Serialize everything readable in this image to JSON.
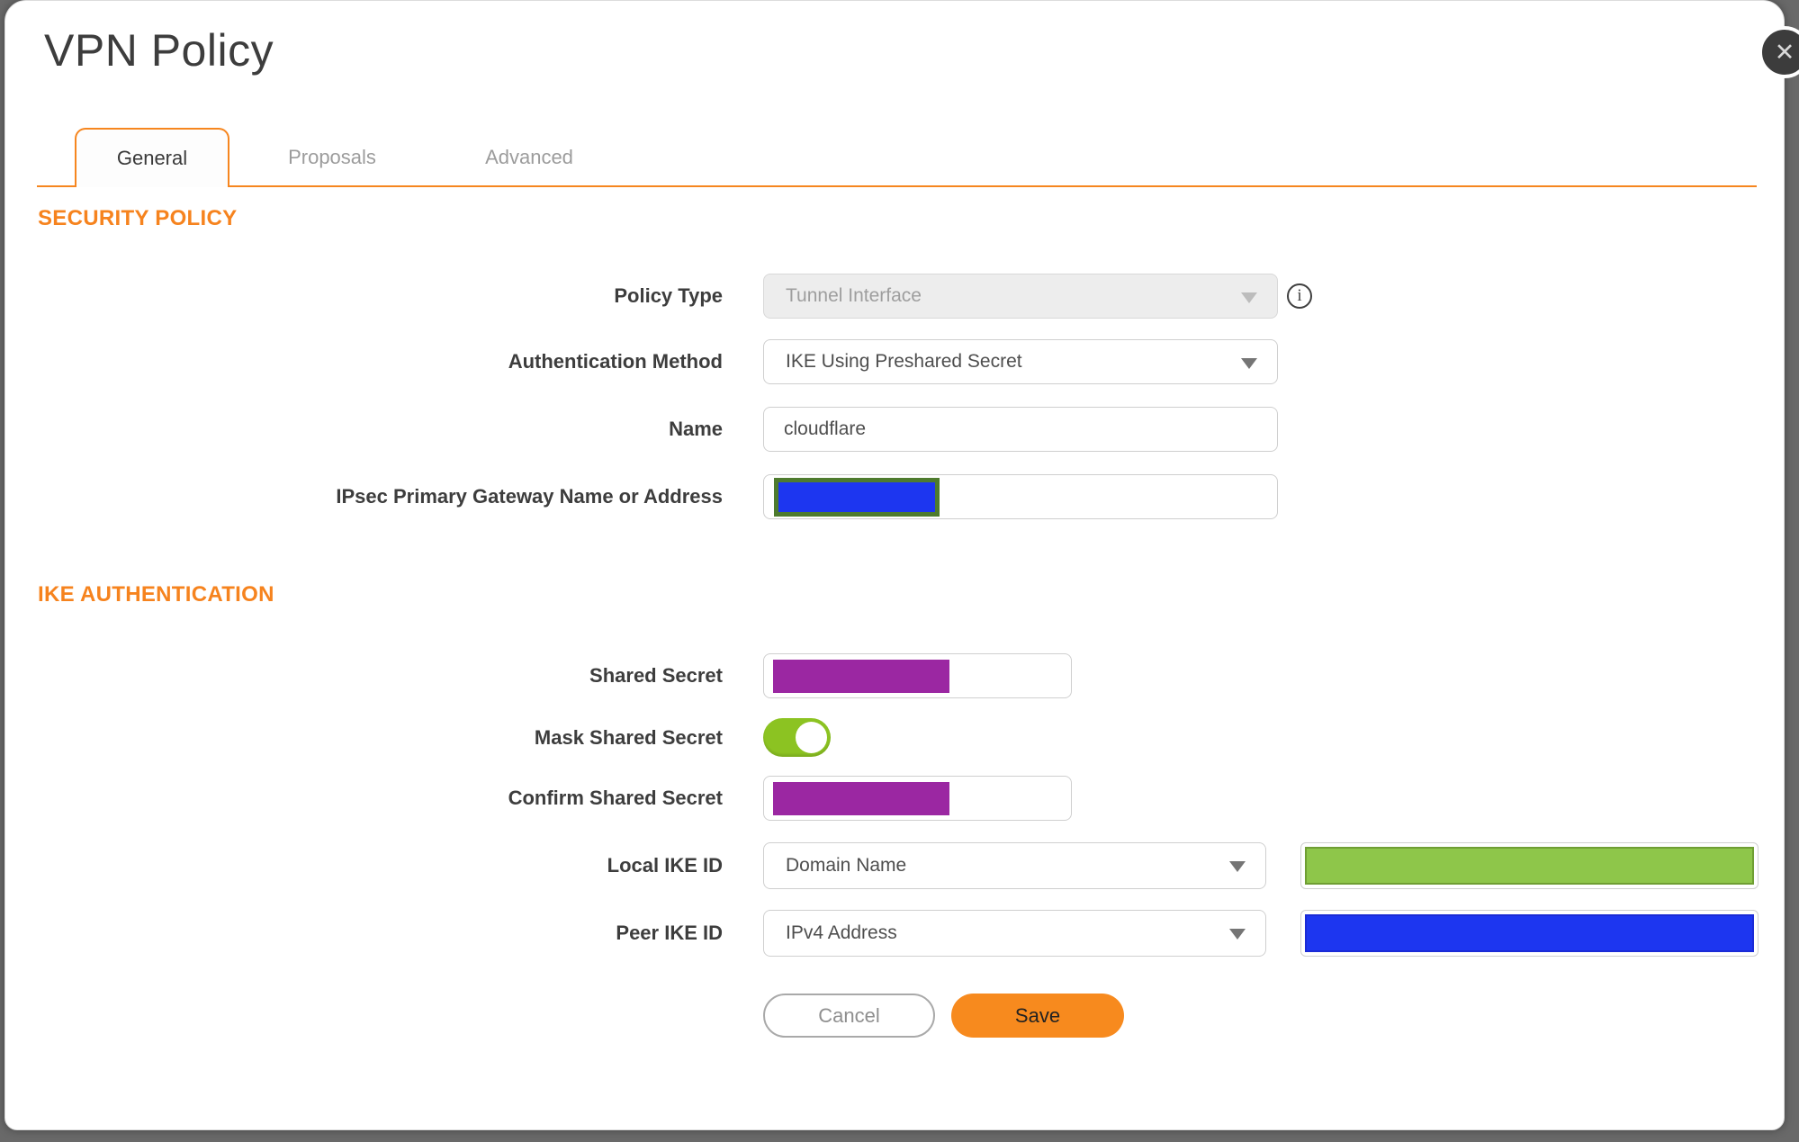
{
  "dialog": {
    "title": "VPN Policy",
    "tabs": [
      {
        "label": "General",
        "active": true
      },
      {
        "label": "Proposals",
        "active": false
      },
      {
        "label": "Advanced",
        "active": false
      }
    ]
  },
  "security_policy": {
    "heading": "SECURITY POLICY",
    "policy_type": {
      "label": "Policy Type",
      "value": "Tunnel Interface",
      "disabled": true
    },
    "authentication_method": {
      "label": "Authentication Method",
      "value": "IKE Using Preshared Secret"
    },
    "name": {
      "label": "Name",
      "value": "cloudflare"
    },
    "gateway": {
      "label": "IPsec Primary Gateway Name or Address",
      "value": "",
      "redacted": true
    }
  },
  "ike_authentication": {
    "heading": "IKE AUTHENTICATION",
    "shared_secret": {
      "label": "Shared Secret",
      "value": "",
      "redacted": true
    },
    "mask_shared_secret": {
      "label": "Mask Shared Secret",
      "enabled": true
    },
    "confirm_shared_secret": {
      "label": "Confirm Shared Secret",
      "value": "",
      "redacted": true
    },
    "local_ike_id": {
      "label": "Local IKE ID",
      "value": "Domain Name",
      "redacted_value": true
    },
    "peer_ike_id": {
      "label": "Peer IKE ID",
      "value": "IPv4 Address",
      "redacted_value": true
    }
  },
  "actions": {
    "cancel": "Cancel",
    "save": "Save"
  },
  "icons": {
    "close": "✕",
    "info": "i"
  },
  "colors": {
    "accent_orange": "#f6861f",
    "save_button_orange": "#f78a1e",
    "redaction_purple": "#9b27a2",
    "redaction_blue": "#1d36f0",
    "redaction_green_fill": "#8ec64a",
    "redaction_olive_border": "#4e7b2e",
    "toggle_on_green": "#8cc322",
    "background_grey": "#696969"
  }
}
